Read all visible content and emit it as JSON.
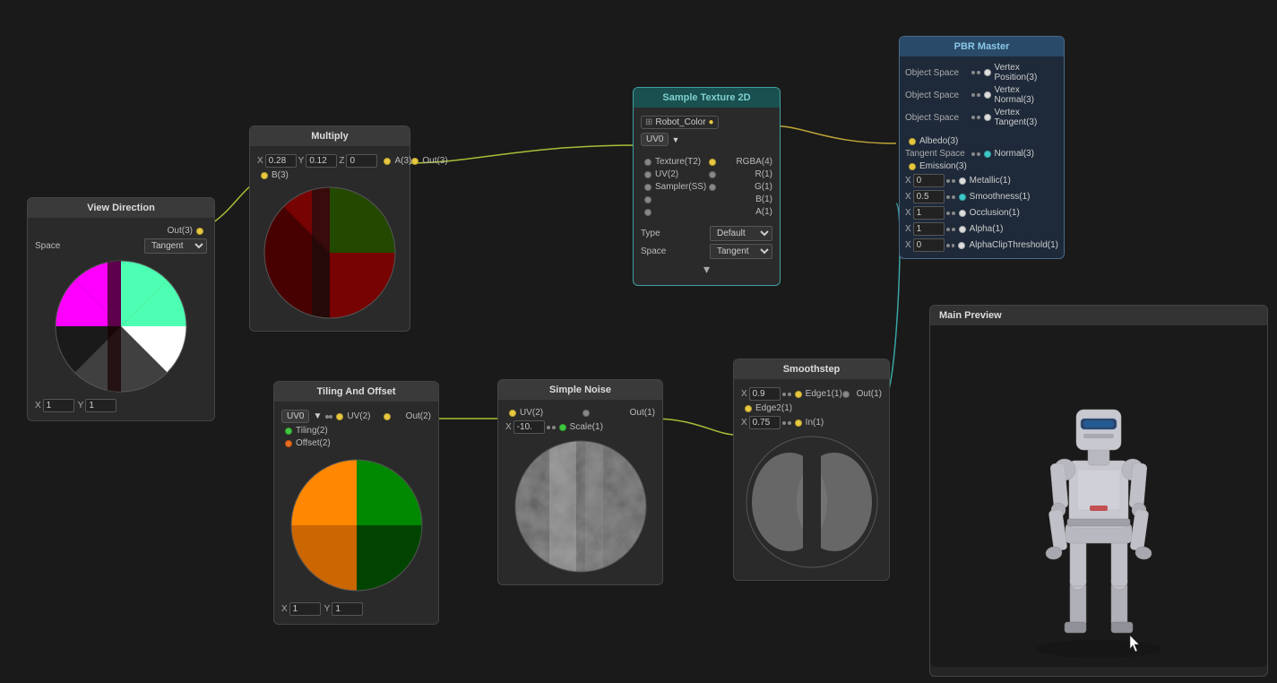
{
  "nodes": {
    "view_direction": {
      "title": "View Direction",
      "space_label": "Space",
      "space_value": "Tangent",
      "out_port": "Out(3)"
    },
    "multiply": {
      "title": "Multiply",
      "inputs": {
        "x": "0.28",
        "y": "0.12",
        "z": "0"
      },
      "ports_in": [
        "A(3)",
        "B(3)"
      ],
      "port_out": "Out(3)"
    },
    "tiling_offset": {
      "title": "Tiling And Offset",
      "uv_label": "UV0",
      "ports_in": [
        "UV(2)",
        "Tiling(2)",
        "Offset(2)"
      ],
      "port_out": "Out(2)"
    },
    "simple_noise": {
      "title": "Simple Noise",
      "ports_in": [
        "UV(2)",
        "Scale(1)"
      ],
      "scale_val": "-10.",
      "port_out": "Out(1)"
    },
    "sample_texture": {
      "title": "Sample Texture 2D",
      "texture_label": "Robot_Color",
      "uv_label": "UV0",
      "ports_in": [
        "Texture(T2)",
        "UV(2)",
        "Sampler(SS)"
      ],
      "ports_out": [
        "RGBA(4)",
        "R(1)",
        "G(1)",
        "B(1)",
        "A(1)"
      ],
      "type_label": "Type",
      "type_value": "Default",
      "space_label": "Space",
      "space_value": "Tangent"
    },
    "smoothstep": {
      "title": "Smoothstep",
      "ports_in": [
        "Edge1(1)",
        "Edge2(1)",
        "In(1)"
      ],
      "port_out": "Out(1)",
      "edge1_val": "0.9",
      "edge2_val": "",
      "in_val": "0.75"
    },
    "pbr_master": {
      "title": "PBR Master",
      "ports_left": [
        "Object Space",
        "Object Space",
        "Object Space",
        "Tangent Space"
      ],
      "ports_left2": [
        "",
        "",
        "",
        ""
      ],
      "ports_right": [
        "Vertex Position(3)",
        "Vertex Normal(3)",
        "Vertex Tangent(3)",
        "Albedo(3)",
        "Normal(3)",
        "Emission(3)",
        "Metallic(1)",
        "Smoothness(1)",
        "Occlusion(1)",
        "Alpha(1)",
        "AlphaClipThreshold(1)"
      ],
      "values": [
        "0",
        "0.5",
        "1",
        "1",
        "0"
      ]
    },
    "main_preview": {
      "title": "Main Preview"
    }
  },
  "colors": {
    "background": "#1a1a1a",
    "node_bg": "#2a2a2a",
    "node_header": "#3a3a3a",
    "accent_yellow": "#e8c840",
    "accent_green": "#40c840",
    "accent_cyan": "#40c8c8",
    "accent_teal": "#1a5a5a",
    "pbr_border": "#4a6a8a"
  }
}
